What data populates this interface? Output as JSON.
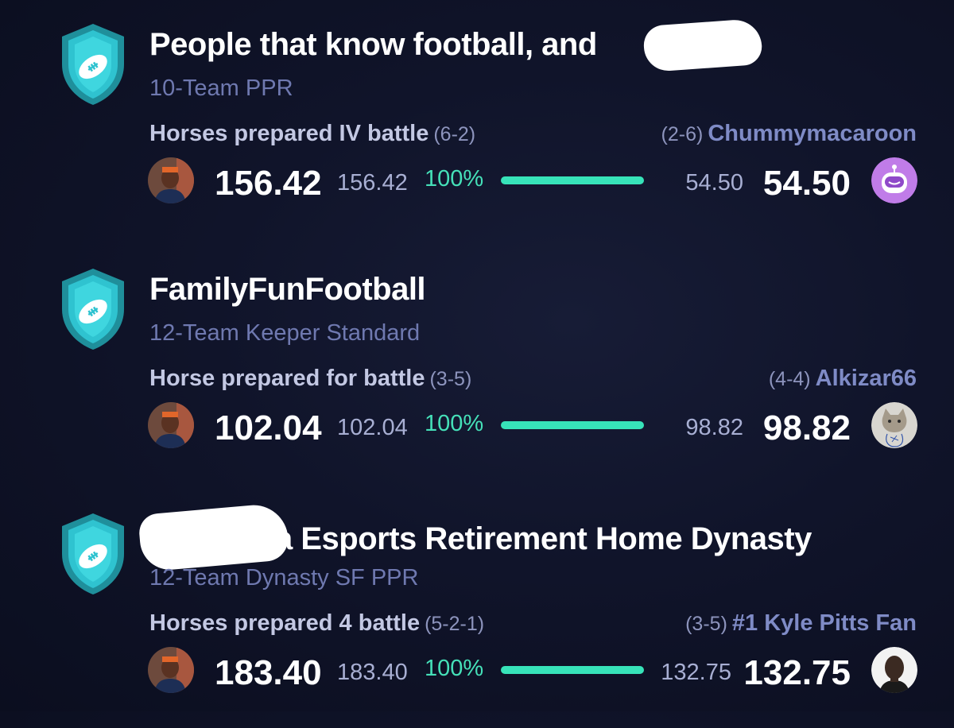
{
  "leagues": [
    {
      "name": "People that know football, and",
      "format": "10-Team PPR",
      "home": {
        "team": "Horses prepared IV battle",
        "record": "(6-2)",
        "score": "156.42",
        "projected": "156.42",
        "win_pct": "100%"
      },
      "away": {
        "team": "Chummymacaroon",
        "record": "(2-6)",
        "score": "54.50",
        "projected": "54.50"
      },
      "win_bar_fraction": 1.0
    },
    {
      "name": "FamilyFunFootball",
      "format": "12-Team Keeper Standard",
      "home": {
        "team": "Horse prepared for battle",
        "record": "(3-5)",
        "score": "102.04",
        "projected": "102.04",
        "win_pct": "100%"
      },
      "away": {
        "team": "Alkizar66",
        "record": "(4-4)",
        "score": "98.82",
        "projected": "98.82"
      },
      "win_bar_fraction": 1.0
    },
    {
      "name": "a Esports Retirement Home Dynasty",
      "format": "12-Team Dynasty SF PPR",
      "home": {
        "team": "Horses prepared 4 battle",
        "record": "(5-2-1)",
        "score": "183.40",
        "projected": "183.40",
        "win_pct": "100%"
      },
      "away": {
        "team": "#1 Kyle Pitts Fan",
        "record": "(3-5)",
        "score": "132.75",
        "projected": "132.75"
      },
      "win_bar_fraction": 1.0
    }
  ],
  "icons": {
    "league": "football-shield-icon",
    "home_avatar": "player-photo-avatar",
    "away_avatars": [
      "purple-robot-avatar",
      "cat-drawing-avatar",
      "player-headshot-avatar"
    ]
  },
  "colors": {
    "background": "#0f1327",
    "accent_green": "#37e3b9",
    "league_format": "#6f79b0",
    "shield": "#2fc3d0"
  }
}
